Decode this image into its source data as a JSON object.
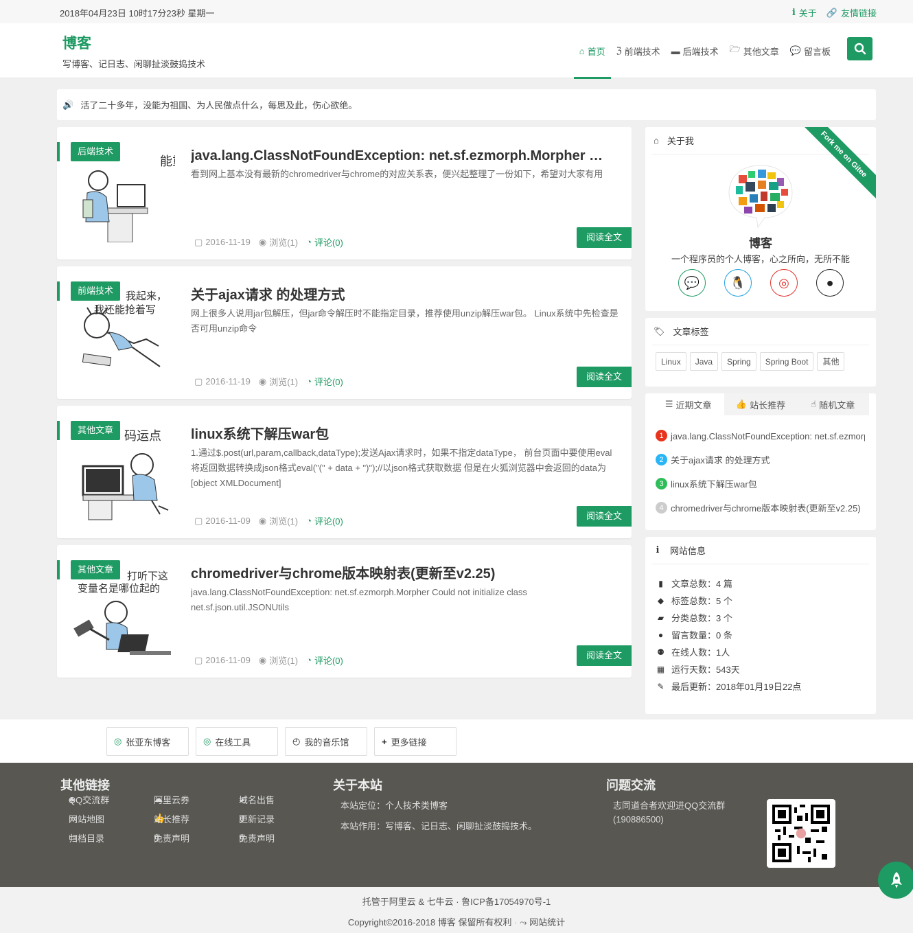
{
  "topbar": {
    "datetime": "2018年04月23日 10时17分23秒 星期一",
    "about": "关于",
    "friendlinks": "友情链接"
  },
  "brand": {
    "name": "博客",
    "slogan": "写博客、记日志、闲聊扯淡鼓捣技术"
  },
  "nav": {
    "items": [
      {
        "label": "首页",
        "icon": "home-icon"
      },
      {
        "label": "前端技术",
        "icon": "css3-icon"
      },
      {
        "label": "后端技术",
        "icon": "keyboard-icon"
      },
      {
        "label": "其他文章",
        "icon": "folder-open-icon"
      },
      {
        "label": "留言板",
        "icon": "comments-icon"
      }
    ]
  },
  "notice": "活了二十多年，没能为祖国、为人民做点什么，每思及此，伤心欲绝。",
  "posts": [
    {
      "category": "后端技术",
      "title": "java.lang.ClassNotFoundException: net.sf.ezmorph.Morpher 异常解决办法",
      "summary": "看到网上基本没有最新的chromedriver与chrome的对应关系表，便兴起整理了一份如下，希望对大家有用",
      "date": "2016-11-19",
      "views": "浏览(1)",
      "comments": "评论(0)",
      "more": "阅读全文",
      "thumb_text": "能重现吗？"
    },
    {
      "category": "前端技术",
      "title": "关于ajax请求 的处理方式",
      "summary": "网上很多人说用jar包解压，但jar命令解压时不能指定目录，推荐使用unzip解压war包。 Linux系统中先检查是否可用unzip命令",
      "date": "2016-11-19",
      "views": "浏览(1)",
      "comments": "评论(0)",
      "more": "阅读全文",
      "thumb_text": "我起来，我还能抢着写"
    },
    {
      "category": "其他文章",
      "title": "linux系统下解压war包",
      "summary": "1.通过$.post(url,param,callback,dataType);发送Ajax请求时，如果不指定dataType， 前台页面中要使用eval将返回数据转换成json格式eval(\"(\" + data + \")\");//以json格式获取数据 但是在火狐浏览器中会返回的data为[object XMLDocument]",
      "date": "2016-11-09",
      "views": "浏览(1)",
      "comments": "评论(0)",
      "more": "阅读全文",
      "thumb_text": "调试代码运点"
    },
    {
      "category": "其他文章",
      "title": "chromedriver与chrome版本映射表(更新至v2.25)",
      "summary": "java.lang.ClassNotFoundException: net.sf.ezmorph.Morpher Could not initialize class net.sf.json.util.JSONUtils",
      "date": "2016-11-09",
      "views": "浏览(1)",
      "comments": "评论(0)",
      "more": "阅读全文",
      "thumb_text": "打听下这变量名是哪位起的"
    }
  ],
  "about": {
    "title": "关于我",
    "ribbon": "Fork me on Gitee",
    "name": "博客",
    "desc": "一个程序员的个人博客，心之所向，无所不能",
    "social": [
      {
        "icon": "wechat-icon",
        "color": "#1e9a63"
      },
      {
        "icon": "qq-icon",
        "color": "#1ea0e0"
      },
      {
        "icon": "weibo-icon",
        "color": "#e0312c"
      },
      {
        "icon": "github-icon",
        "color": "#222222"
      }
    ]
  },
  "tags": {
    "title": "文章标签",
    "items": [
      "Linux",
      "Java",
      "Spring",
      "Spring Boot",
      "其他"
    ]
  },
  "tabs": {
    "items": [
      "近期文章",
      "站长推荐",
      "随机文章"
    ]
  },
  "recent": [
    {
      "n": "1",
      "color": "#e8341c",
      "text": "java.lang.ClassNotFoundException: net.sf.ezmorph.Morpher 异常解决办法"
    },
    {
      "n": "2",
      "color": "#29b6f6",
      "text": "关于ajax请求 的处理方式"
    },
    {
      "n": "3",
      "color": "#2ebd59",
      "text": "linux系统下解压war包"
    },
    {
      "n": "4",
      "color": "#cccccc",
      "text": "chromedriver与chrome版本映射表(更新至v2.25)"
    }
  ],
  "siteinfo": {
    "title": "网站信息",
    "items": [
      {
        "icon": "file-icon",
        "text": "文章总数：4 篇"
      },
      {
        "icon": "tags-icon",
        "text": "标签总数：5 个"
      },
      {
        "icon": "folder-icon",
        "text": "分类总数：3 个"
      },
      {
        "icon": "comments-icon",
        "text": "留言数量：0 条"
      },
      {
        "icon": "users-icon",
        "text": "在线人数：1人"
      },
      {
        "icon": "calendar-icon",
        "text": "运行天数：543天"
      },
      {
        "icon": "edit-icon",
        "text": "最后更新：2018年01月19日22点"
      }
    ]
  },
  "friends": [
    {
      "icon": "logo-icon",
      "label": "张亚东博客"
    },
    {
      "icon": "logo-icon",
      "label": "在线工具"
    },
    {
      "icon": "music-icon",
      "label": "我的音乐馆"
    },
    {
      "icon": "plus-icon",
      "label": "更多链接"
    }
  ],
  "footer": {
    "other_title": "其他链接",
    "other_links": [
      {
        "icon": "qq-icon",
        "label": "QQ交流群"
      },
      {
        "icon": "cloud-icon",
        "label": "阿里云券"
      },
      {
        "icon": "globe-icon",
        "label": "域名出售"
      },
      {
        "icon": "map-icon",
        "label": "网站地图"
      },
      {
        "icon": "thumbs-up-icon",
        "label": "站长推荐"
      },
      {
        "icon": "file-icon",
        "label": "更新记录"
      },
      {
        "icon": "folder-icon",
        "label": "归档目录"
      },
      {
        "icon": "file-icon",
        "label": "免责声明"
      },
      {
        "icon": "file-icon",
        "label": "免责声明"
      }
    ],
    "about_title": "关于本站",
    "about_lines": [
      "本站定位：个人技术类博客",
      "本站作用：写博客、记日志、闲聊扯淡鼓捣技术。"
    ],
    "qa_title": "问题交流",
    "qa_text": "志同道合者欢迎进QQ交流群(190886500)"
  },
  "bottom": {
    "hosting": "托管于阿里云 & 七牛云 · 鲁ICP备17054970号-1",
    "copyright": "Copyright©2016-2018 博客 保留所有权利",
    "stats": "网站统计"
  }
}
